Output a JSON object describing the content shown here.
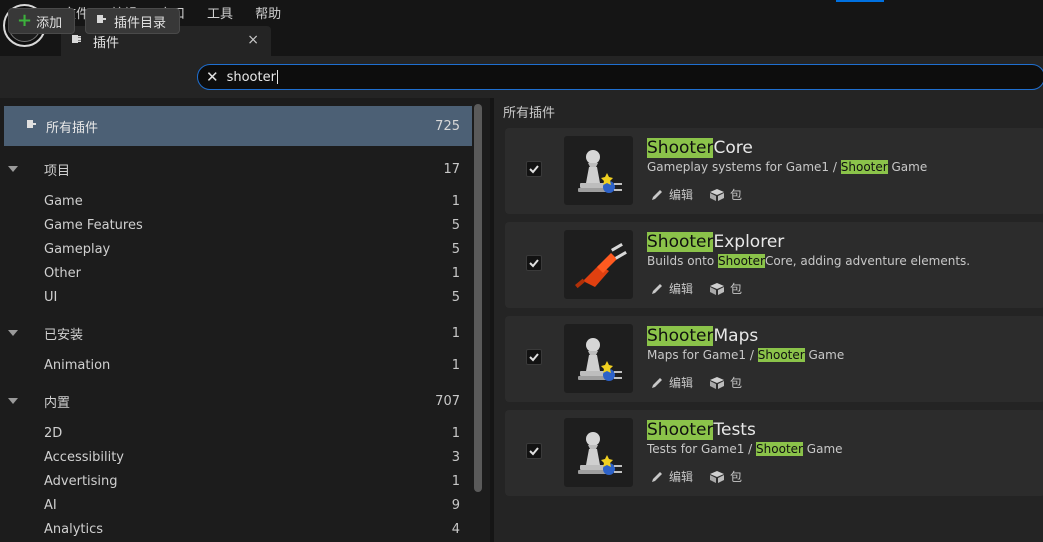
{
  "menu": [
    "文件",
    "编辑",
    "窗口",
    "工具",
    "帮助"
  ],
  "tab": {
    "label": "插件",
    "close": "×"
  },
  "toolbar": {
    "add_label": "添加",
    "catalog_label": "插件目录"
  },
  "search": {
    "value": "shooter"
  },
  "sidebar": {
    "all": {
      "label": "所有插件",
      "count": "725"
    },
    "groups": [
      {
        "label": "项目",
        "count": "17",
        "items": [
          {
            "label": "Game",
            "count": "1"
          },
          {
            "label": "Game Features",
            "count": "5"
          },
          {
            "label": "Gameplay",
            "count": "5"
          },
          {
            "label": "Other",
            "count": "1"
          },
          {
            "label": "UI",
            "count": "5"
          }
        ]
      },
      {
        "label": "已安装",
        "count": "1",
        "items": [
          {
            "label": "Animation",
            "count": "1"
          }
        ]
      },
      {
        "label": "内置",
        "count": "707",
        "items": [
          {
            "label": "2D",
            "count": "1"
          },
          {
            "label": "Accessibility",
            "count": "3"
          },
          {
            "label": "Advertising",
            "count": "1"
          },
          {
            "label": "AI",
            "count": "9"
          },
          {
            "label": "Analytics",
            "count": "4"
          }
        ]
      }
    ]
  },
  "main": {
    "title": "所有插件",
    "edit_label": "编辑",
    "package_label": "包",
    "plugins": [
      {
        "name_hl": "Shooter",
        "name_rest": "Core",
        "desc_pre": "Gameplay systems for Game1 / ",
        "desc_hl": "Shooter",
        "desc_post": " Game",
        "enabled": true,
        "icon": "pawn-plug-icon"
      },
      {
        "name_hl": "Shooter",
        "name_rest": "Explorer",
        "desc_pre": "Builds onto ",
        "desc_hl": "Shooter",
        "desc_post": "Core, adding adventure elements.",
        "enabled": true,
        "icon": "red-plug-icon"
      },
      {
        "name_hl": "Shooter",
        "name_rest": "Maps",
        "desc_pre": "Maps for Game1 / ",
        "desc_hl": "Shooter",
        "desc_post": " Game",
        "enabled": true,
        "icon": "pawn-plug-icon"
      },
      {
        "name_hl": "Shooter",
        "name_rest": "Tests",
        "desc_pre": "Tests for Game1 / ",
        "desc_hl": "Shooter",
        "desc_post": " Game",
        "enabled": true,
        "icon": "pawn-plug-icon"
      }
    ]
  },
  "colors": {
    "accent": "#1f6fd0",
    "highlight": "#8bc34a",
    "selected_row": "#4c6075",
    "add_plus": "#3cb13c"
  }
}
